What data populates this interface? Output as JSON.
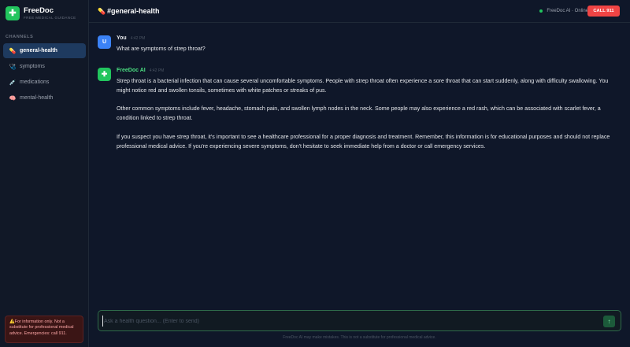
{
  "app": {
    "name": "FreeDoc",
    "subtitle": "FREE MEDICAL GUIDANCE",
    "logo_glyph": "✚"
  },
  "sidebar": {
    "section_label": "CHANNELS",
    "channels": [
      {
        "label": "general-health",
        "icon": "pill-icon",
        "glyph": "💊",
        "active": true
      },
      {
        "label": "symptoms",
        "icon": "stethoscope-icon",
        "glyph": "🩺",
        "active": false
      },
      {
        "label": "medications",
        "icon": "syringe-icon",
        "glyph": "💉",
        "active": false
      },
      {
        "label": "mental-health",
        "icon": "brain-icon",
        "glyph": "🧠",
        "active": false
      }
    ],
    "disclaimer": "⚠️For information only. Not a substitute for professional medical advice. Emergencies: call 911."
  },
  "header": {
    "channel_glyph": "💊",
    "channel_name": "#general-health",
    "status_text": "FreeDoc AI · Online",
    "call_label": "CALL 911"
  },
  "messages": [
    {
      "avatar": "U",
      "author": "You",
      "time": "4:42 PM",
      "paragraphs": [
        "What are symptoms of strep throat?"
      ]
    },
    {
      "avatar": "✚",
      "author": "FreeDoc AI",
      "time": "4:42 PM",
      "paragraphs": [
        "Strep throat is a bacterial infection that can cause several uncomfortable symptoms. People with strep throat often experience a sore throat that can start suddenly, along with difficulty swallowing. You might notice red and swollen tonsils, sometimes with white patches or streaks of pus.",
        "Other common symptoms include fever, headache, stomach pain, and swollen lymph nodes in the neck. Some people may also experience a red rash, which can be associated with scarlet fever, a condition linked to strep throat.",
        "If you suspect you have strep throat, it's important to see a healthcare professional for a proper diagnosis and treatment. Remember, this information is for educational purposes and should not replace professional medical advice. If you're experiencing severe symptoms, don't hesitate to seek immediate help from a doctor or call emergency services."
      ]
    }
  ],
  "composer": {
    "placeholder": "Ask a health question... (Enter to send)",
    "value": "",
    "send_glyph": "↑"
  },
  "footnote": "FreeDoc AI may make mistakes. This is not a substitute for professional medical advice.",
  "colors": {
    "background": "#0f1729",
    "sidebar": "#111827",
    "accent_green": "#22c55e",
    "user_avatar": "#3b82f6",
    "emergency_red": "#ef4444",
    "active_channel": "#1e3a5f"
  }
}
